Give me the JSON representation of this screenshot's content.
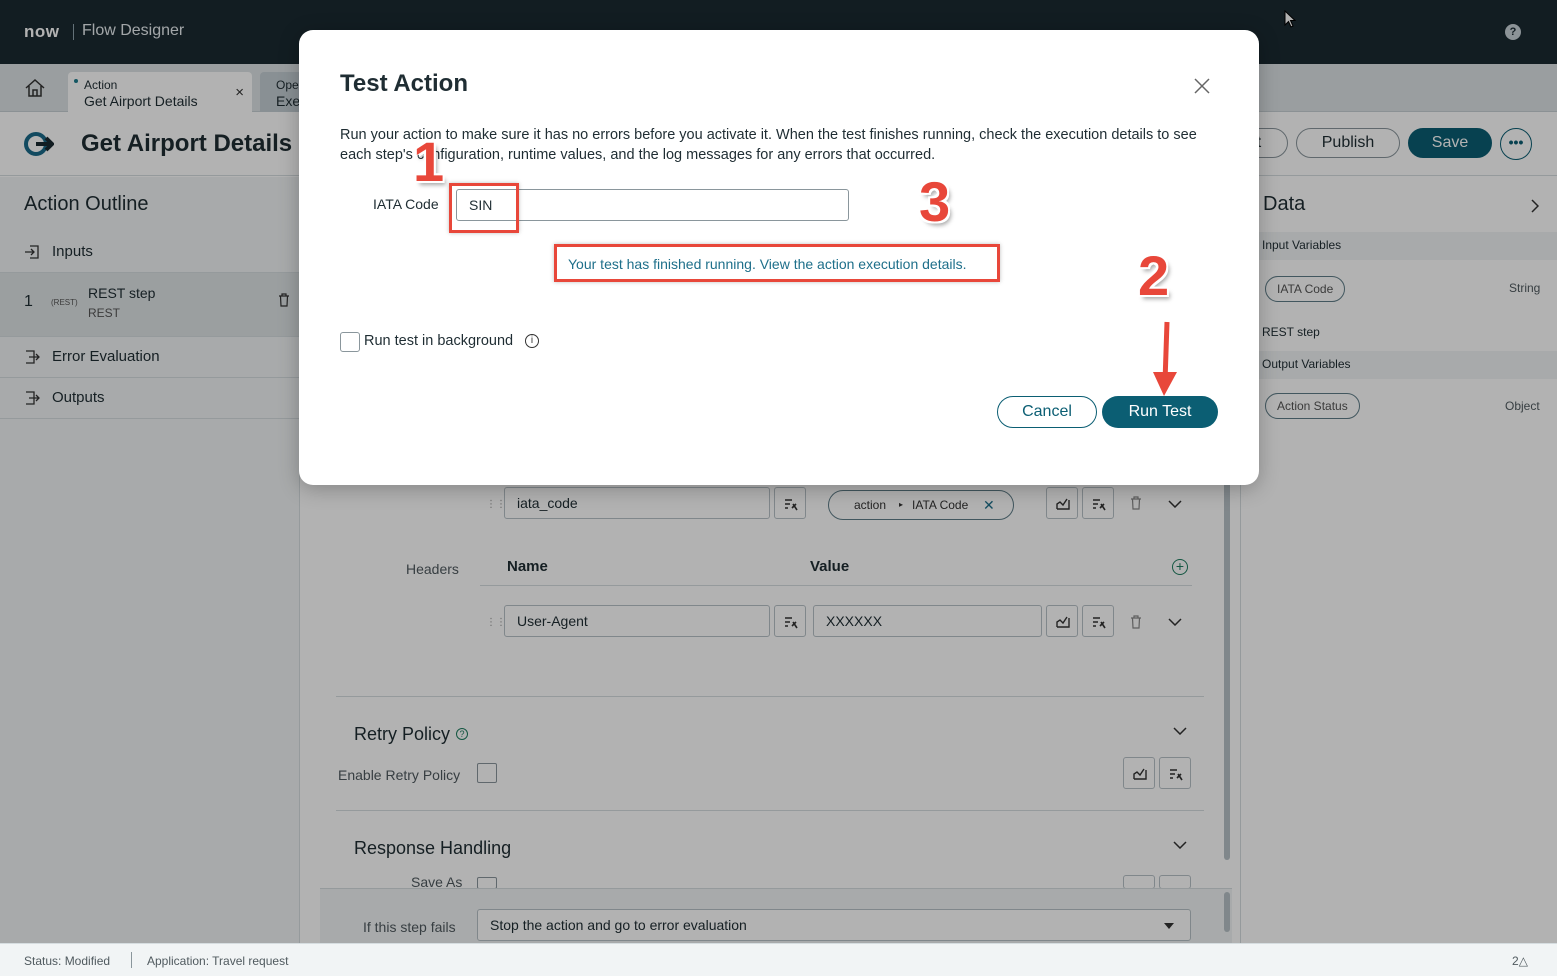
{
  "header": {
    "logo": "now",
    "app_name": "Flow Designer",
    "help_glyph": "?"
  },
  "tabs": [
    {
      "type": "Action",
      "title": "Get Airport Details",
      "close_glyph": "×",
      "active": true
    },
    {
      "type": "Ope",
      "title": "Exe",
      "active": false
    }
  ],
  "page": {
    "title": "Get Airport Details",
    "buttons": {
      "test_label": "t",
      "publish_label": "Publish",
      "save_label": "Save",
      "more_glyph": "•••"
    }
  },
  "outline": {
    "title": "Action Outline",
    "items": [
      {
        "label": "Inputs",
        "icon": "input-icon"
      },
      {
        "label": "Error Evaluation",
        "icon": "error-eval-icon"
      },
      {
        "label": "Outputs",
        "icon": "output-icon"
      }
    ],
    "step": {
      "number": "1",
      "tag": "(REST)",
      "name": "REST step",
      "type": "REST"
    }
  },
  "main": {
    "query_param": {
      "name": "iata_code",
      "value_chip": {
        "left": "action",
        "right": "IATA Code"
      }
    },
    "headers": {
      "label": "Headers",
      "col_name": "Name",
      "col_value": "Value",
      "row": {
        "name": "User-Agent",
        "value": "XXXXXX"
      }
    },
    "retry": {
      "title": "Retry Policy",
      "enable_label": "Enable Retry Policy"
    },
    "response": {
      "title": "Response Handling",
      "save_as_label": "Save As"
    },
    "fail": {
      "label": "If this step fails",
      "selected": "Stop the action and go to error evaluation"
    }
  },
  "data_panel": {
    "title": "Data",
    "groups": [
      {
        "label": "Input Variables",
        "pill": "IATA Code",
        "type": "String"
      },
      {
        "label": "REST step"
      },
      {
        "label": "Output Variables",
        "pill": "Action Status",
        "type": "Object"
      }
    ]
  },
  "status": {
    "modified": "Status: Modified",
    "application": "Application: Travel request",
    "notifications": "2"
  },
  "modal": {
    "title": "Test Action",
    "description": "Run your action to make sure it has no errors before you activate it. When the test finishes running, check the execution details to see each step's configuration, runtime values, and the log messages for any errors that occurred.",
    "iata_label": "IATA Code",
    "iata_value": "SIN",
    "result_link": "Your test has finished running. View the action execution details.",
    "background_label": "Run test in background",
    "info_glyph": "i",
    "cancel_label": "Cancel",
    "run_label": "Run Test",
    "annotations": [
      "1",
      "2",
      "3"
    ],
    "annotation_color": "#e8473a"
  },
  "colors": {
    "brand_dark": "#1b2a32",
    "primary": "#0b5e73",
    "link": "#1e6f8a"
  }
}
